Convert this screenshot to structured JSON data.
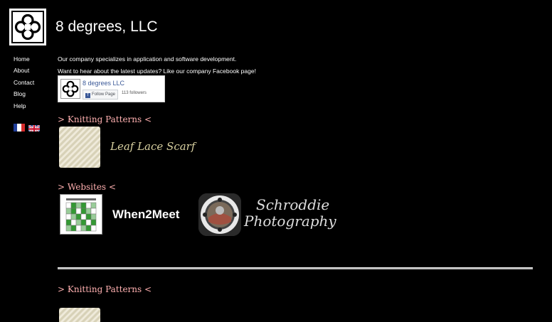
{
  "header": {
    "title": "8 degrees, LLC"
  },
  "nav": {
    "items": [
      {
        "label": "Home"
      },
      {
        "label": "About"
      },
      {
        "label": "Contact"
      },
      {
        "label": "Blog"
      },
      {
        "label": "Help"
      }
    ],
    "languages": [
      "french-flag-icon",
      "uk-flag-icon"
    ]
  },
  "main": {
    "intro": "Our company specializes in application and software development.",
    "updates": "Want to hear about the latest updates? Like our company Facebook page!",
    "facebook": {
      "page_name": "8 degrees LLC",
      "follow_label": "Follow Page",
      "followers": "113 followers"
    },
    "knitting_heading": "> Knitting Patterns <",
    "knitting_items": [
      {
        "label": "Leaf Lace Scarf"
      }
    ],
    "websites_heading": "> Websites <",
    "websites": [
      {
        "label": "When2Meet"
      },
      {
        "label_line1": "Schroddie",
        "label_line2": "Photography"
      }
    ],
    "knitting_heading_2": "> Knitting Patterns <"
  },
  "colors": {
    "background": "#000000",
    "section_heading": "#ffb0b0",
    "facebook_blue": "#3b5998"
  }
}
